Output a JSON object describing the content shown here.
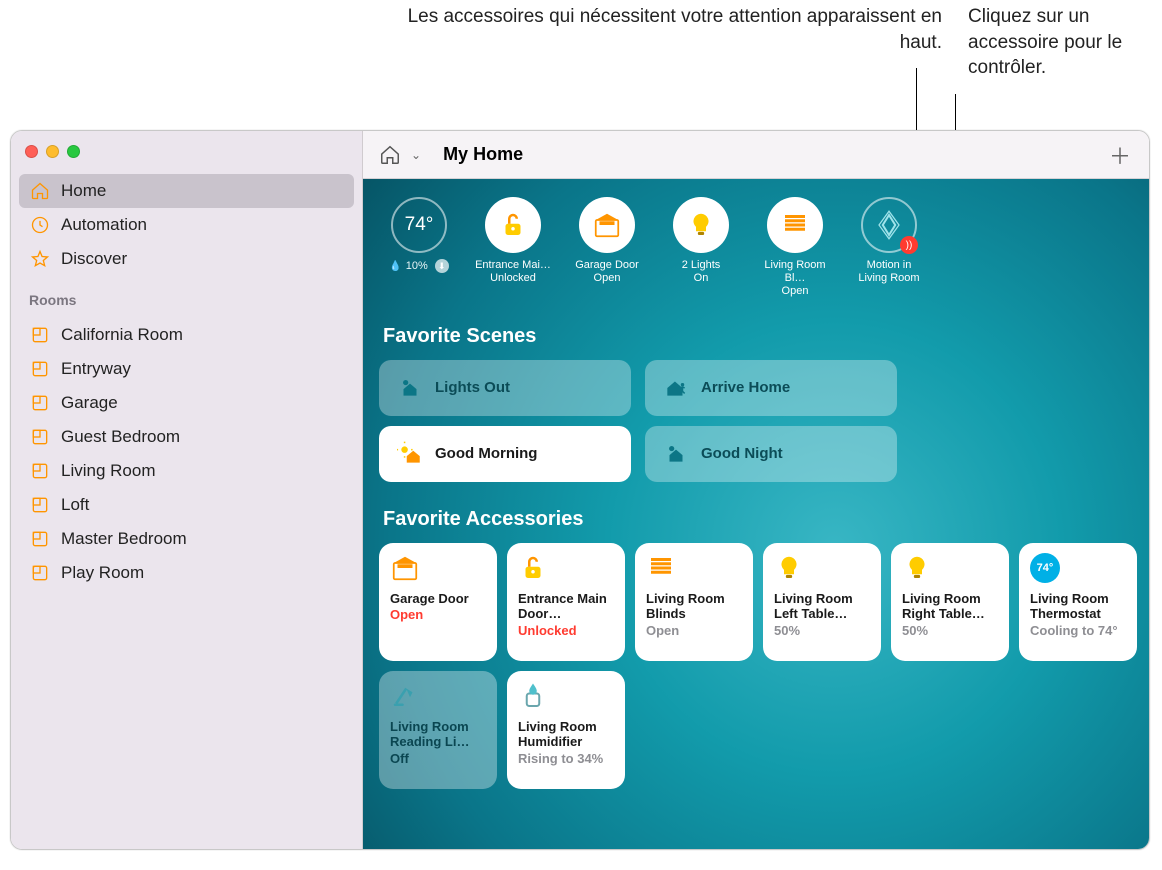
{
  "callouts": {
    "attention": "Les accessoires qui nécessitent votre attention apparaissent en haut.",
    "control": "Cliquez sur un accessoire pour le contrôler."
  },
  "sidebar": {
    "items": [
      {
        "label": "Home",
        "icon": "house-icon",
        "selected": true
      },
      {
        "label": "Automation",
        "icon": "clock-icon",
        "selected": false
      },
      {
        "label": "Discover",
        "icon": "star-icon",
        "selected": false
      }
    ],
    "section_label": "Rooms",
    "rooms": [
      {
        "label": "California Room"
      },
      {
        "label": "Entryway"
      },
      {
        "label": "Garage"
      },
      {
        "label": "Guest Bedroom"
      },
      {
        "label": "Living Room"
      },
      {
        "label": "Loft"
      },
      {
        "label": "Master Bedroom"
      },
      {
        "label": "Play Room"
      }
    ]
  },
  "toolbar": {
    "title": "My Home"
  },
  "climate": {
    "temp": "74°",
    "humidity": "10%"
  },
  "status": [
    {
      "icon": "lock-open-icon",
      "line1": "Entrance Mai…",
      "line2": "Unlocked"
    },
    {
      "icon": "garage-icon",
      "line1": "Garage Door",
      "line2": "Open"
    },
    {
      "icon": "bulb-icon",
      "line1": "2 Lights",
      "line2": "On"
    },
    {
      "icon": "blinds-icon",
      "line1": "Living Room Bl…",
      "line2": "Open"
    },
    {
      "icon": "motion-icon",
      "line1": "Motion in",
      "line2": "Living Room",
      "outline": true,
      "alert": true
    }
  ],
  "sections": {
    "scenes": "Favorite Scenes",
    "accessories": "Favorite Accessories"
  },
  "scenes": [
    {
      "label": "Lights Out",
      "icon": "moon-house-icon",
      "active": false
    },
    {
      "label": "Arrive Home",
      "icon": "house-person-icon",
      "active": false
    },
    {
      "label": "Good Morning",
      "icon": "sun-house-icon",
      "active": true
    },
    {
      "label": "Good Night",
      "icon": "moon-house-icon",
      "active": false
    }
  ],
  "accessories": [
    {
      "name": "Garage Door",
      "state": "Open",
      "state_class": "red",
      "icon": "garage-icon",
      "off": false
    },
    {
      "name": "Entrance Main Door…",
      "state": "Unlocked",
      "state_class": "red",
      "icon": "lock-open-icon",
      "off": false
    },
    {
      "name": "Living Room Blinds",
      "state": "Open",
      "state_class": "gray",
      "icon": "blinds-icon",
      "off": false
    },
    {
      "name": "Living Room Left Table…",
      "state": "50%",
      "state_class": "gray",
      "icon": "bulb-icon",
      "off": false
    },
    {
      "name": "Living Room Right Table…",
      "state": "50%",
      "state_class": "gray",
      "icon": "bulb-icon",
      "off": false
    },
    {
      "name": "Living Room Thermostat",
      "state": "Cooling to 74°",
      "state_class": "gray",
      "icon": "thermo-icon",
      "off": false,
      "badge": "74°"
    },
    {
      "name": "Living Room Reading Li…",
      "state": "Off",
      "state_class": "",
      "icon": "lamp-icon",
      "off": true
    },
    {
      "name": "Living Room Humidifier",
      "state": "Rising to 34%",
      "state_class": "gray",
      "icon": "humidifier-icon",
      "off": false
    }
  ]
}
